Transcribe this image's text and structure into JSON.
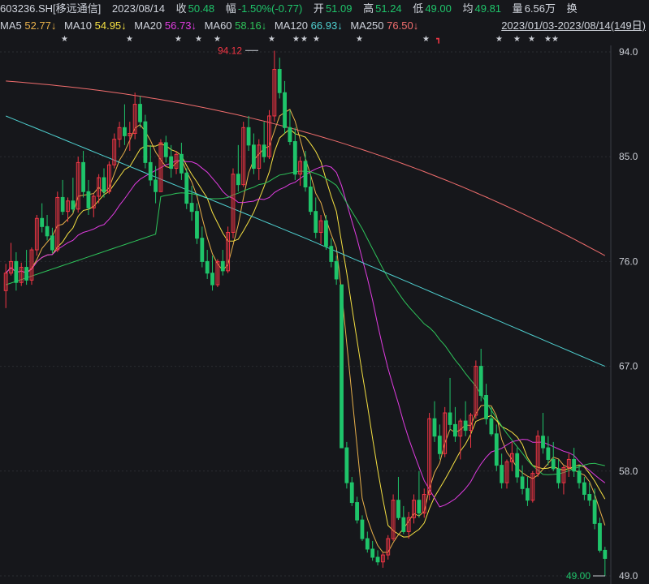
{
  "header": {
    "code": "603236.SH[移远通信]",
    "date": "2023/08/14",
    "close_label": "收",
    "close": "50.48",
    "change_label": "幅",
    "change": "-1.50%(-0.77)",
    "open_label": "开",
    "open": "51.09",
    "high_label": "高",
    "high": "51.24",
    "low_label": "低",
    "low": "49.00",
    "avg_label": "均",
    "avg": "49.81",
    "vol_label": "量",
    "vol": "6.56万",
    "turnover_label": "换"
  },
  "ma": [
    {
      "name": "MA5",
      "value": "52.77↓",
      "color": "#e8b04a"
    },
    {
      "name": "MA10",
      "value": "54.95↓",
      "color": "#f5e042"
    },
    {
      "name": "MA20",
      "value": "56.73↓",
      "color": "#e03ce0"
    },
    {
      "name": "MA60",
      "value": "58.16↓",
      "color": "#2ec45a"
    },
    {
      "name": "MA120",
      "value": "66.93↓",
      "color": "#4fd1d1"
    },
    {
      "name": "MA250",
      "value": "76.50↓",
      "color": "#f06d6d"
    }
  ],
  "range": "2023/01/03-2023/08/14(149日)",
  "colors": {
    "up": "#f23645",
    "down": "#1fc46a",
    "bg": "#16171b"
  },
  "chart_data": {
    "type": "candlestick",
    "y_ticks": [
      "94.0",
      "85.0",
      "76.0",
      "67.0",
      "58.0",
      "49.0"
    ],
    "ylim": [
      48.5,
      95.5
    ],
    "high_marker": "94.12",
    "low_marker": "49.00",
    "grid": true
  }
}
